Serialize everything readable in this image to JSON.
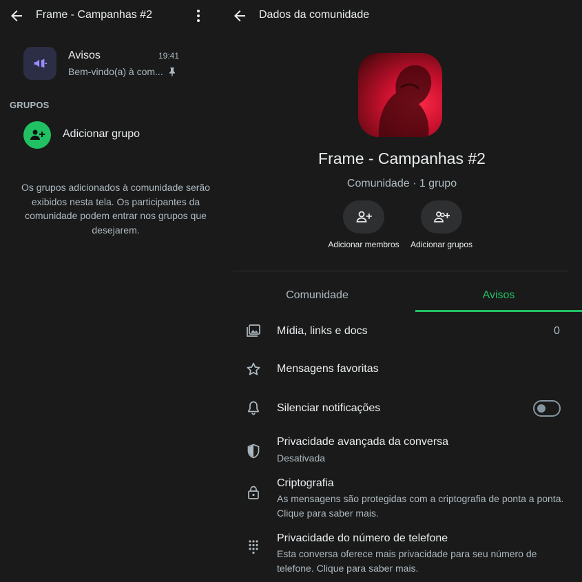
{
  "left": {
    "header_title": "Frame - Campanhas #2",
    "avisos": {
      "name": "Avisos",
      "time": "19:41",
      "preview": "Bem-vindo(a) à com..."
    },
    "section_title": "GRUPOS",
    "add_group_label": "Adicionar grupo",
    "info": "Os grupos adicionados à comunidade serão exibidos nesta tela. Os participantes da comunidade podem entrar nos grupos que desejarem."
  },
  "right": {
    "header_title": "Dados da comunidade",
    "community_name": "Frame - Campanhas #2",
    "community_sub": "Comunidade · 1 grupo",
    "actions": [
      {
        "label": "Adicionar membros",
        "icon": "add-person-icon"
      },
      {
        "label": "Adicionar grupos",
        "icon": "add-group-icon"
      }
    ],
    "tabs": [
      {
        "label": "Comunidade",
        "active": false
      },
      {
        "label": "Avisos",
        "active": true
      }
    ],
    "items": [
      {
        "title": "Mídia, links e docs",
        "count": "0",
        "icon": "media-icon"
      },
      {
        "title": "Mensagens favoritas",
        "icon": "star-icon"
      },
      {
        "title": "Silenciar notificações",
        "icon": "bell-icon",
        "toggle_on": false
      },
      {
        "title": "Privacidade avançada da conversa",
        "subtitle": "Desativada",
        "icon": "shield-icon"
      },
      {
        "title": "Criptografia",
        "subtitle": "As mensagens são protegidas com a criptografia de ponta a ponta. Clique para saber mais.",
        "icon": "lock-icon"
      },
      {
        "title": "Privacidade do número de telefone",
        "subtitle": "Esta conversa oferece mais privacidade para seu número de telefone. Clique para saber mais.",
        "icon": "dialpad-icon"
      }
    ]
  },
  "colors": {
    "accent": "#21c063",
    "background": "#1a1a1a",
    "muted_text": "#aebac1"
  }
}
